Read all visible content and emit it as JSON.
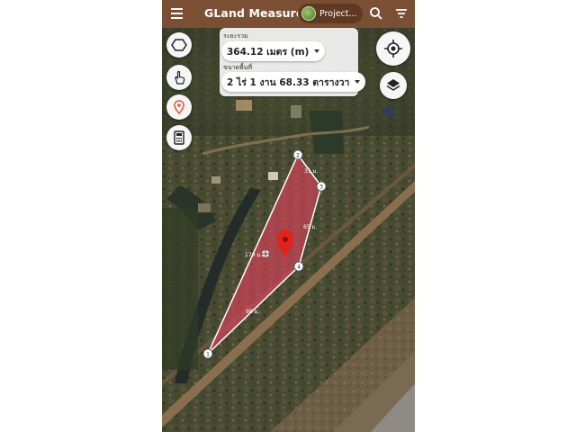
{
  "app": {
    "title": "GLand Measure"
  },
  "toolbar": {
    "menu_icon": "menu-icon",
    "project_label": "Project...",
    "search_icon": "search-icon",
    "filter_icon": "filter-icon"
  },
  "measurement": {
    "distance_label": "ระยะรวม",
    "distance_value": "364.12 เมตร (m)",
    "area_label": "ขนาดพื้นที่",
    "area_value": "2 ไร่ 1 งาน 68.33 ตารางวา"
  },
  "tools": [
    "polygon-tool-icon",
    "touch-tool-icon",
    "pin-tool-icon",
    "calculator-icon"
  ],
  "map_controls": [
    "my-location-icon",
    "layers-icon"
  ],
  "polygon": {
    "fill_color": "#e0405c",
    "vertex_labels": [
      "1",
      "2",
      "3",
      "4"
    ],
    "edge_labels": [
      "31 ม.",
      "65 ม.",
      "170 ม.",
      "98 ม."
    ]
  }
}
